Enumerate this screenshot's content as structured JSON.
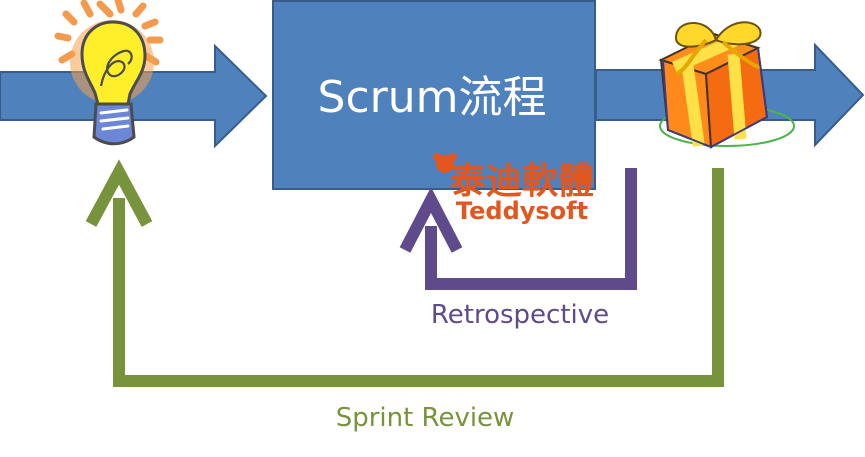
{
  "process": {
    "title": "Scrum流程"
  },
  "loops": {
    "retrospective_label": "Retrospective",
    "sprint_review_label": "Sprint Review"
  },
  "watermark": {
    "chinese_name": "泰迪軟體",
    "english_name": "Teddysoft"
  },
  "icons": {
    "idea": "lightbulb-icon",
    "product": "gift-box-icon"
  },
  "colors": {
    "flow_arrow": "#4f81bd",
    "flow_arrow_stroke": "#385d8a",
    "process_box": "#4f81bd",
    "retrospective": "#5f4b8b",
    "sprint_review": "#77933c",
    "watermark": "#e2561f",
    "title_text": "#ffffff"
  }
}
